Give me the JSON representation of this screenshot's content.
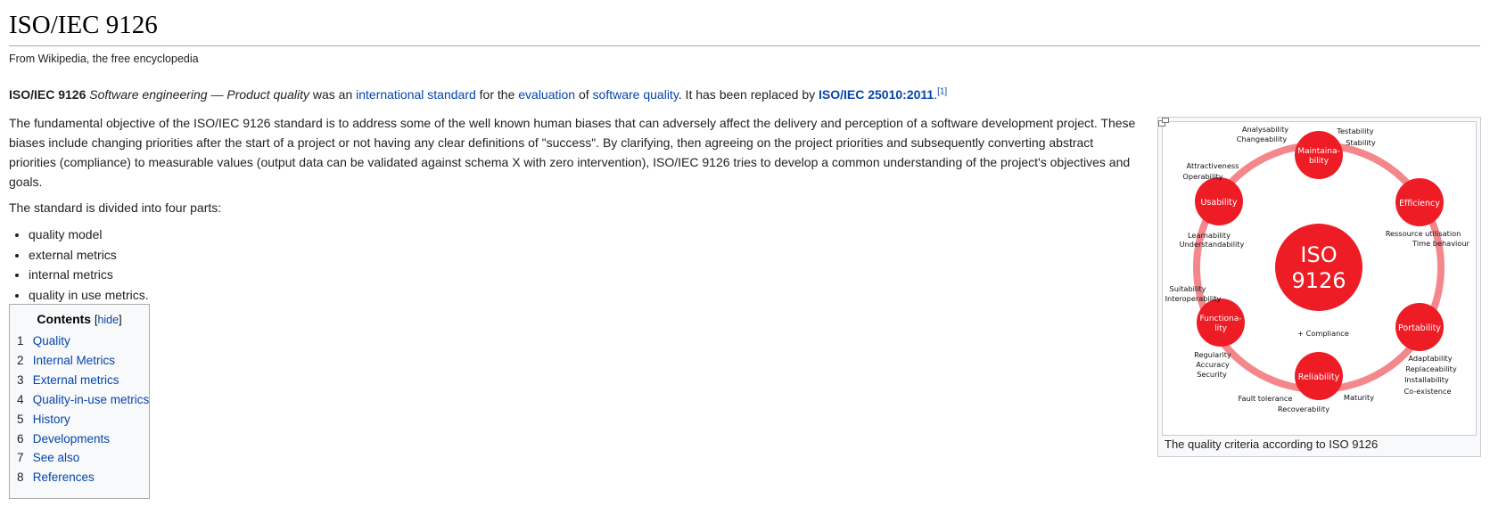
{
  "page": {
    "title": "ISO/IEC 9126",
    "tagline": "From Wikipedia, the free encyclopedia"
  },
  "intro": {
    "bold": "ISO/IEC 9126",
    "italic": "Software engineering — Product quality",
    "t1": " was an ",
    "link1": "international standard",
    "t2": " for the ",
    "link2": "evaluation",
    "t3": " of ",
    "link3": "software quality",
    "t4": ". It has been replaced by ",
    "link4": "ISO/IEC 25010:2011",
    "t5": ".",
    "ref": "[1]"
  },
  "para2": "The fundamental objective of the ISO/IEC 9126 standard is to address some of the well known human biases that can adversely affect the delivery and perception of a software development project. These biases include changing priorities after the start of a project or not having any clear definitions of \"success\". By clarifying, then agreeing on the project priorities and subsequently converting abstract priorities (compliance) to measurable values (output data can be validated against schema X with zero intervention), ISO/IEC 9126 tries to develop a common understanding of the project's objectives and goals.",
  "para3": "The standard is divided into four parts:",
  "parts": [
    "quality model",
    "external metrics",
    "internal metrics",
    "quality in use metrics."
  ],
  "toc": {
    "title": "Contents",
    "hide_open": "[",
    "hide": "hide",
    "hide_close": "]",
    "items": [
      {
        "num": "1",
        "label": "Quality"
      },
      {
        "num": "2",
        "label": "Internal Metrics"
      },
      {
        "num": "3",
        "label": "External metrics"
      },
      {
        "num": "4",
        "label": "Quality-in-use metrics"
      },
      {
        "num": "5",
        "label": "History"
      },
      {
        "num": "6",
        "label": "Developments"
      },
      {
        "num": "7",
        "label": "See also"
      },
      {
        "num": "8",
        "label": "References"
      }
    ]
  },
  "figure": {
    "caption": "The quality criteria according to ISO 9126",
    "center_line1": "ISO",
    "center_line2": "9126",
    "compliance": "+ Compliance",
    "nodes": {
      "maintainability_1": "Maintaina-",
      "maintainability_2": "bility",
      "efficiency": "Efficiency",
      "portability": "Portability",
      "reliability": "Reliability",
      "functionality_1": "Functiona-",
      "functionality_2": "lity",
      "usability": "Usability"
    },
    "labels": {
      "analysability": "Analysability",
      "changeability": "Changeability",
      "testability": "Testability",
      "stability": "Stability",
      "attractiveness": "Attractiveness",
      "operability": "Operability",
      "learnability": "Learnability",
      "understandability": "Understandability",
      "resource_utilisation": "Ressource utilisation",
      "time_behaviour": "Time behaviour",
      "suitability": "Suitability",
      "interoperability": "Interoperability",
      "regularity": "Regularity",
      "accuracy": "Accuracy",
      "security": "Security",
      "adaptability": "Adaptability",
      "replaceability": "Replaceability",
      "installability": "Installability",
      "coexistence": "Co-existence",
      "fault_tolerance": "Fault tolerance",
      "recoverability": "Recoverability",
      "maturity": "Maturity"
    },
    "colors": {
      "node": "#ee1c25",
      "ring": "#f4878c"
    }
  }
}
